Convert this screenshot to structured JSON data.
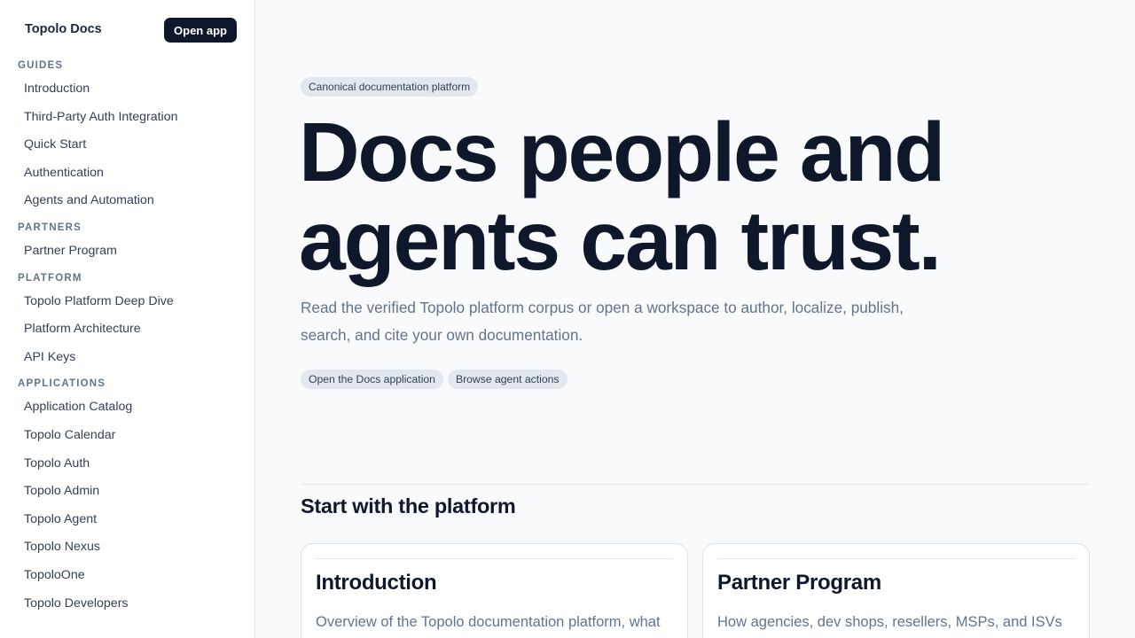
{
  "sidebar": {
    "brand": "Topolo Docs",
    "open_app_label": "Open app",
    "sections": [
      {
        "title": "GUIDES",
        "items": [
          "Introduction",
          "Third-Party Auth Integration",
          "Quick Start",
          "Authentication",
          "Agents and Automation"
        ]
      },
      {
        "title": "PARTNERS",
        "items": [
          "Partner Program"
        ]
      },
      {
        "title": "PLATFORM",
        "items": [
          "Topolo Platform Deep Dive",
          "Platform Architecture",
          "API Keys"
        ]
      },
      {
        "title": "APPLICATIONS",
        "items": [
          "Application Catalog",
          "Topolo Calendar",
          "Topolo Auth",
          "Topolo Admin",
          "Topolo Agent",
          "Topolo Nexus",
          "TopoloOne",
          "Topolo Developers"
        ]
      }
    ]
  },
  "hero": {
    "eyebrow": "Canonical documentation platform",
    "title_line1": "Docs people and",
    "title_line2": "agents can trust.",
    "description": "Read the verified Topolo platform corpus or open a workspace to author, localize, publish, search, and cite your own documentation.",
    "actions": [
      "Open the Docs application",
      "Browse agent actions"
    ]
  },
  "platform": {
    "section_title": "Start with the platform",
    "cards": [
      {
        "title": "Introduction",
        "description": "Overview of the Topolo documentation platform, what"
      },
      {
        "title": "Partner Program",
        "description": "How agencies, dev shops, resellers, MSPs, and ISVs"
      }
    ]
  }
}
